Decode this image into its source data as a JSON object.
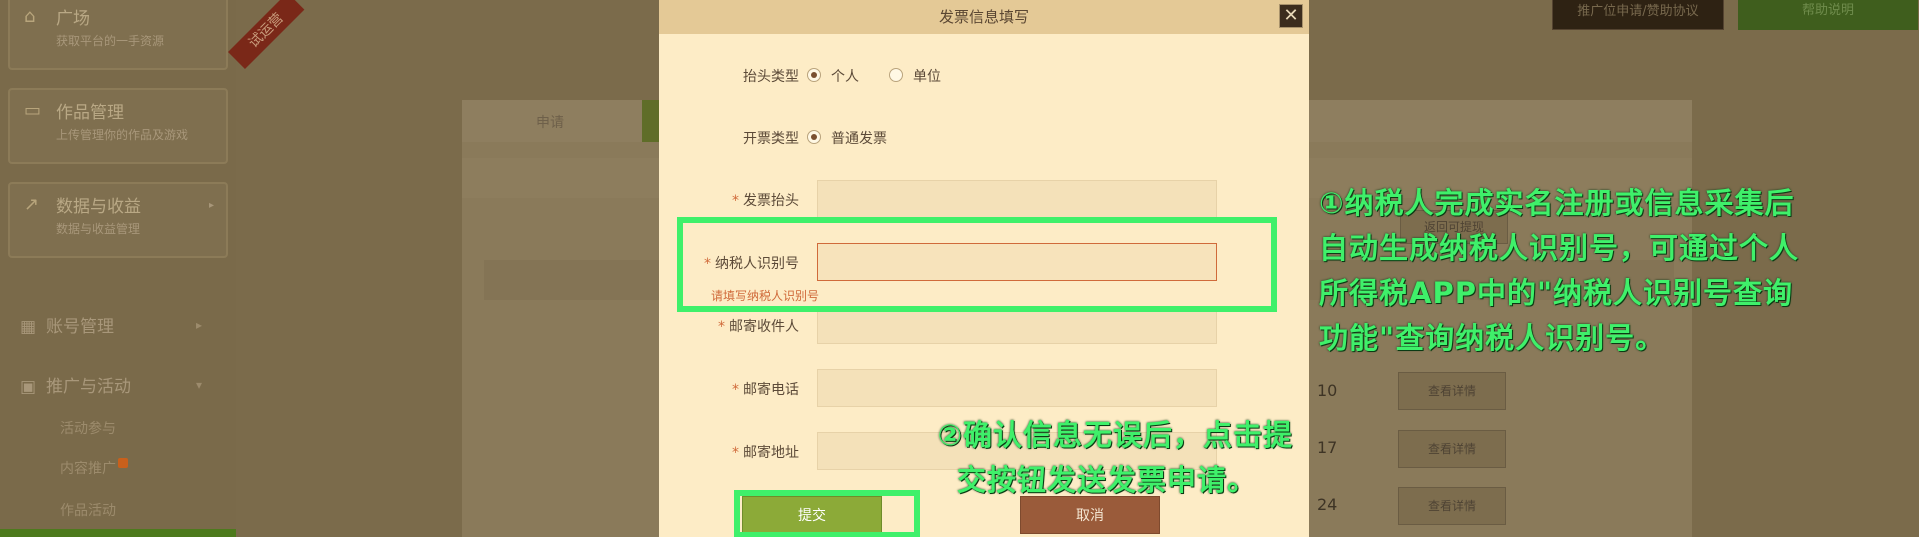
{
  "background": {
    "sidebar": {
      "cards": [
        {
          "title": "广场",
          "subtitle": "获取平台的一手资源"
        },
        {
          "title": "作品管理",
          "subtitle": "上传管理你的作品及游戏"
        },
        {
          "title": "数据与收益",
          "subtitle": "数据与收益管理"
        }
      ],
      "menu": [
        {
          "label": "账号管理"
        },
        {
          "label": "推广与活动"
        }
      ],
      "submenu": [
        "活动参与",
        "内容推广",
        "作品活动"
      ]
    },
    "ribbon_text": "试运营",
    "top_buttons": [
      "推广位申请/赞助协议",
      "帮助说明"
    ],
    "tabs": [
      "申请"
    ],
    "return_button": "返回可提现",
    "table": {
      "numbers": [
        "10",
        "17",
        "24"
      ],
      "detail_button": "查看详情"
    }
  },
  "modal": {
    "title": "发票信息填写",
    "close_glyph": "✕",
    "header_type": {
      "label": "抬头类型",
      "options": [
        "个人",
        "单位"
      ],
      "selected": "个人"
    },
    "invoice_type": {
      "label": "开票类型",
      "option": "普通发票"
    },
    "fields": {
      "invoice_title": "发票抬头",
      "taxpayer_id": "纳税人识别号",
      "recipient": "邮寄收件人",
      "phone": "邮寄电话",
      "address": "邮寄地址"
    },
    "required_mark": "*",
    "taxpayer_error": "请填写纳税人识别号",
    "submit_label": "提交",
    "cancel_label": "取消"
  },
  "annotations": {
    "note1": [
      "①纳税人完成实名注册或信息采集后",
      "自动生成纳税人识别号，可通过个人",
      "所得税APP中的\"纳税人识别号查询",
      "功能\"查询纳税人识别号。"
    ],
    "note2": [
      "②确认信息无误后，点击提",
      "交按钮发送发票申请。"
    ]
  },
  "colors": {
    "highlight": "#3ff06a",
    "modal_bg": "#fdecc6",
    "submit": "#8caa38",
    "cancel": "#9a5b3a",
    "error": "#d06a3a"
  }
}
